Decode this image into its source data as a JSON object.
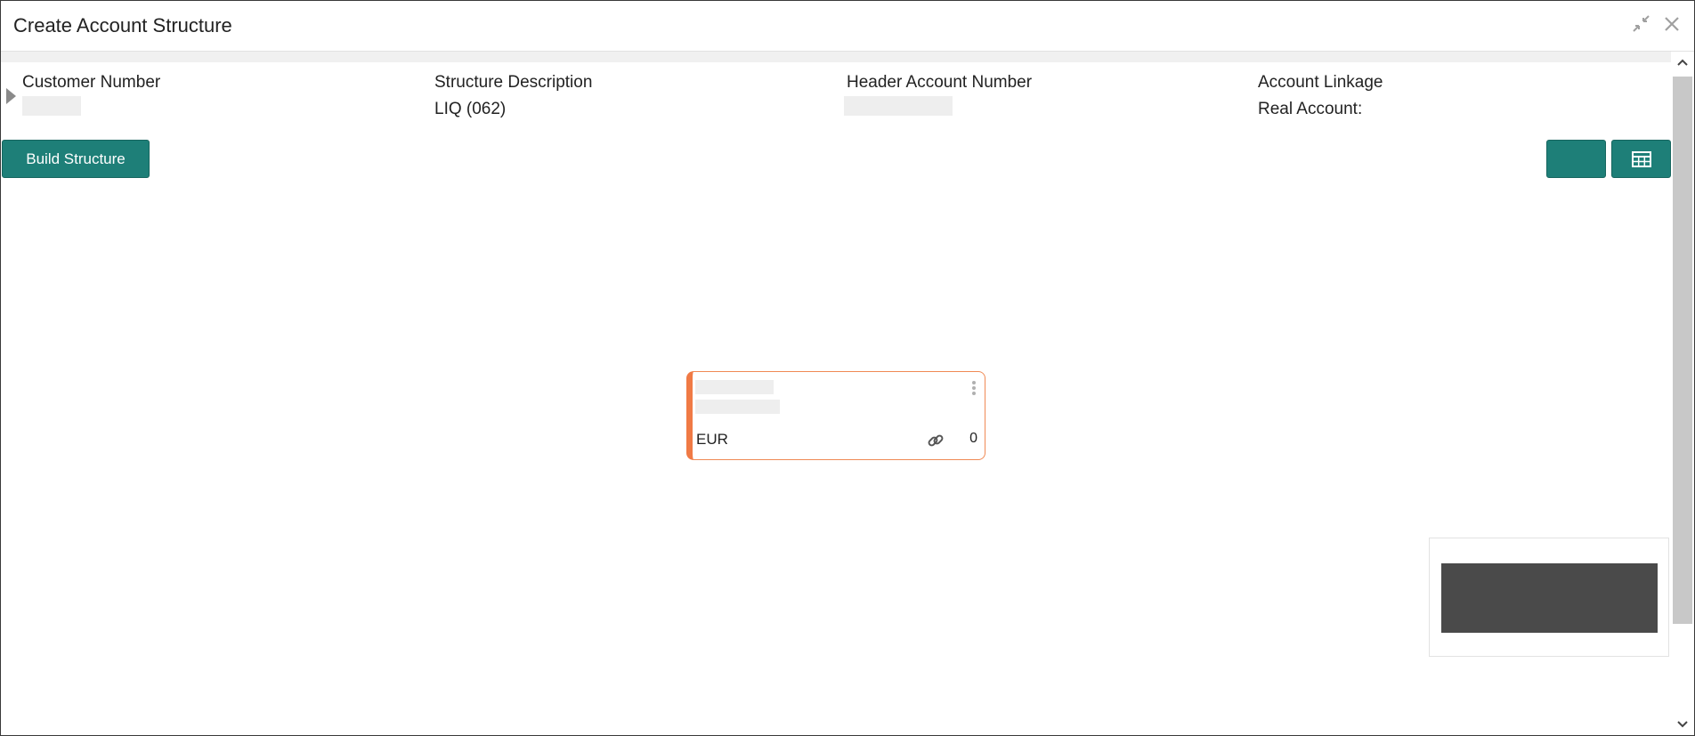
{
  "window": {
    "title": "Create Account Structure",
    "minimize_icon": "collapse-arrows-icon",
    "close_icon": "close-icon"
  },
  "summary": {
    "customer_number_label": "Customer Number",
    "structure_description_label": "Structure Description",
    "structure_description_value": "LIQ (062)",
    "header_account_label": "Header Account Number",
    "account_linkage_label": "Account Linkage",
    "account_linkage_value": "Real Account:"
  },
  "toolbar": {
    "build_structure_label": "Build Structure",
    "grid_view_icon": "table-grid-icon"
  },
  "node": {
    "currency": "EUR",
    "link_icon": "link-icon",
    "count": "0",
    "menu_icon": "kebab-menu-icon"
  },
  "colors": {
    "primary": "#1e7f78",
    "node_accent": "#f07a45",
    "mask": "#eeeeee",
    "overview_viewport": "#4a4a4a"
  }
}
